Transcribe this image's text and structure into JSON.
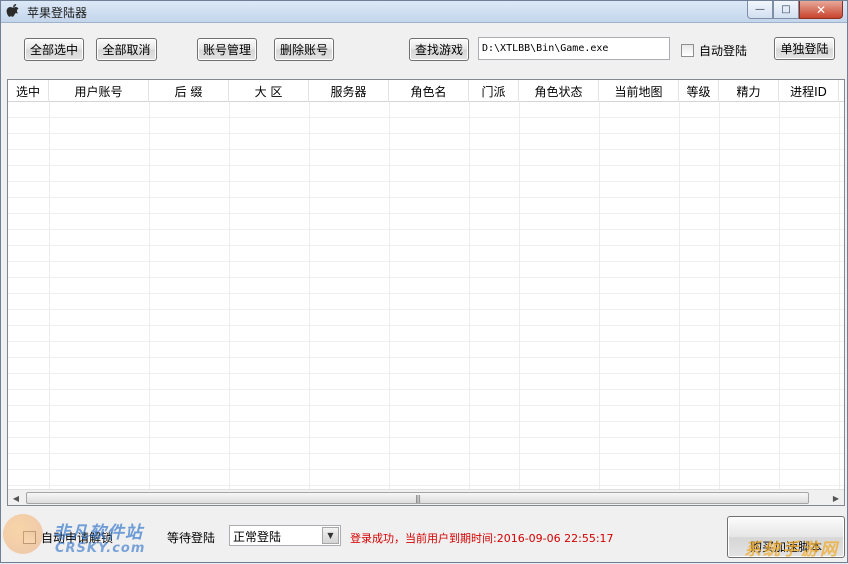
{
  "window": {
    "title": "苹果登陆器",
    "caption_minimize": "—",
    "caption_maximize": "□",
    "caption_close": "✕"
  },
  "toolbar": {
    "select_all": "全部选中",
    "deselect_all": "全部取消",
    "account_manage": "账号管理",
    "delete_account": "删除账号",
    "find_game": "查找游戏",
    "game_path": "D:\\XTLBB\\Bin\\Game.exe",
    "auto_login": "自动登陆",
    "single_login": "单独登陆"
  },
  "grid": {
    "columns": [
      "选中",
      "用户账号",
      "后 缀",
      "大 区",
      "服务器",
      "角色名",
      "门派",
      "角色状态",
      "当前地图",
      "等级",
      "精力",
      "进程ID"
    ],
    "rows": []
  },
  "scrollbar": {
    "left_arrow": "◀",
    "right_arrow": "▶",
    "grip": "|||"
  },
  "bottom": {
    "auto_checkbox_label": "自动申请解锁",
    "wait_label": "等待登陆",
    "login_mode": "正常登陆",
    "status_text": "登录成功，当前用户到期时间:2016-09-06 22:55:17",
    "buy_script": "购买加速脚本"
  },
  "watermarks": {
    "left_cn": "非凡软件站",
    "left_en": "CRSKY.com",
    "right": "系统手游网"
  }
}
